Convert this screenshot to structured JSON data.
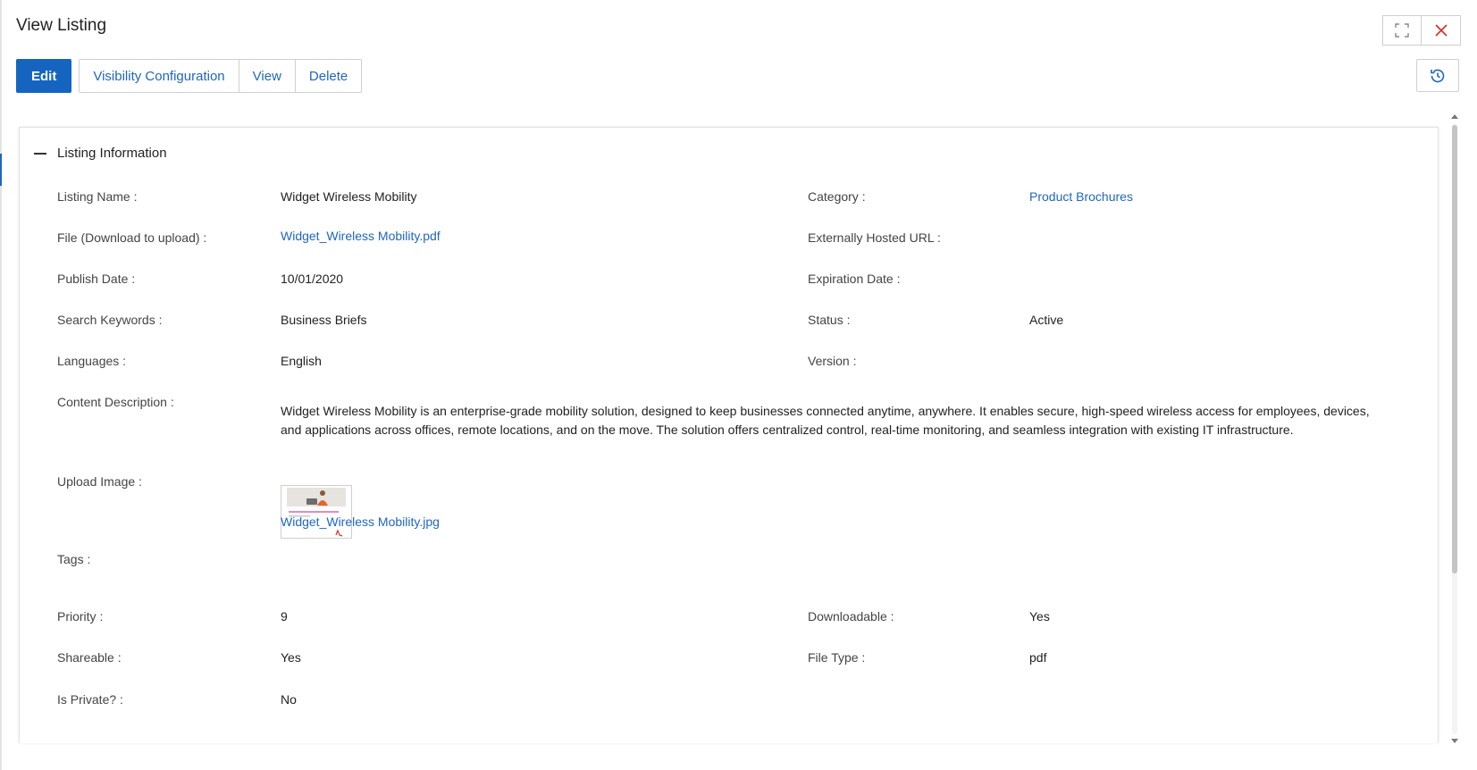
{
  "window": {
    "title": "View Listing",
    "icons": {
      "expand": "expand-icon",
      "close": "close-icon",
      "history": "history-icon"
    },
    "colors": {
      "primary": "#1565c0",
      "link": "#1f66c1",
      "close": "#d32f2f"
    }
  },
  "toolbar": {
    "edit_label": "Edit",
    "visibility_label": "Visibility Configuration",
    "view_label": "View",
    "delete_label": "Delete"
  },
  "section": {
    "title": "Listing Information",
    "fields": {
      "listing_name": {
        "label": "Listing Name :",
        "value": "Widget Wireless Mobility"
      },
      "category": {
        "label": "Category :",
        "value": "Product Brochures"
      },
      "file": {
        "label": "File (Download to upload) :",
        "value": "Widget_Wireless Mobility.pdf"
      },
      "external_url": {
        "label": "Externally Hosted URL :",
        "value": ""
      },
      "publish_date": {
        "label": "Publish Date :",
        "value": "10/01/2020"
      },
      "expiration_date": {
        "label": "Expiration Date :",
        "value": ""
      },
      "search_keywords": {
        "label": "Search Keywords :",
        "value": "Business Briefs"
      },
      "status": {
        "label": "Status :",
        "value": "Active"
      },
      "languages": {
        "label": "Languages :",
        "value": "English"
      },
      "version": {
        "label": "Version :",
        "value": ""
      },
      "content_description": {
        "label": "Content Description :",
        "value": "Widget Wireless Mobility is an enterprise-grade mobility solution, designed to keep businesses connected anytime, anywhere. It enables secure, high-speed wireless access for employees, devices, and applications across offices, remote locations, and on the move. The solution offers centralized control, real-time monitoring, and seamless integration with existing IT infrastructure."
      },
      "upload_image": {
        "label": "Upload Image :",
        "value": "Widget_Wireless Mobility.jpg"
      },
      "tags": {
        "label": "Tags :",
        "value": ""
      },
      "priority": {
        "label": "Priority :",
        "value": "9"
      },
      "downloadable": {
        "label": "Downloadable :",
        "value": "Yes"
      },
      "shareable": {
        "label": "Shareable :",
        "value": "Yes"
      },
      "file_type": {
        "label": "File Type :",
        "value": "pdf"
      },
      "is_private": {
        "label": "Is Private? :",
        "value": "No"
      }
    }
  }
}
